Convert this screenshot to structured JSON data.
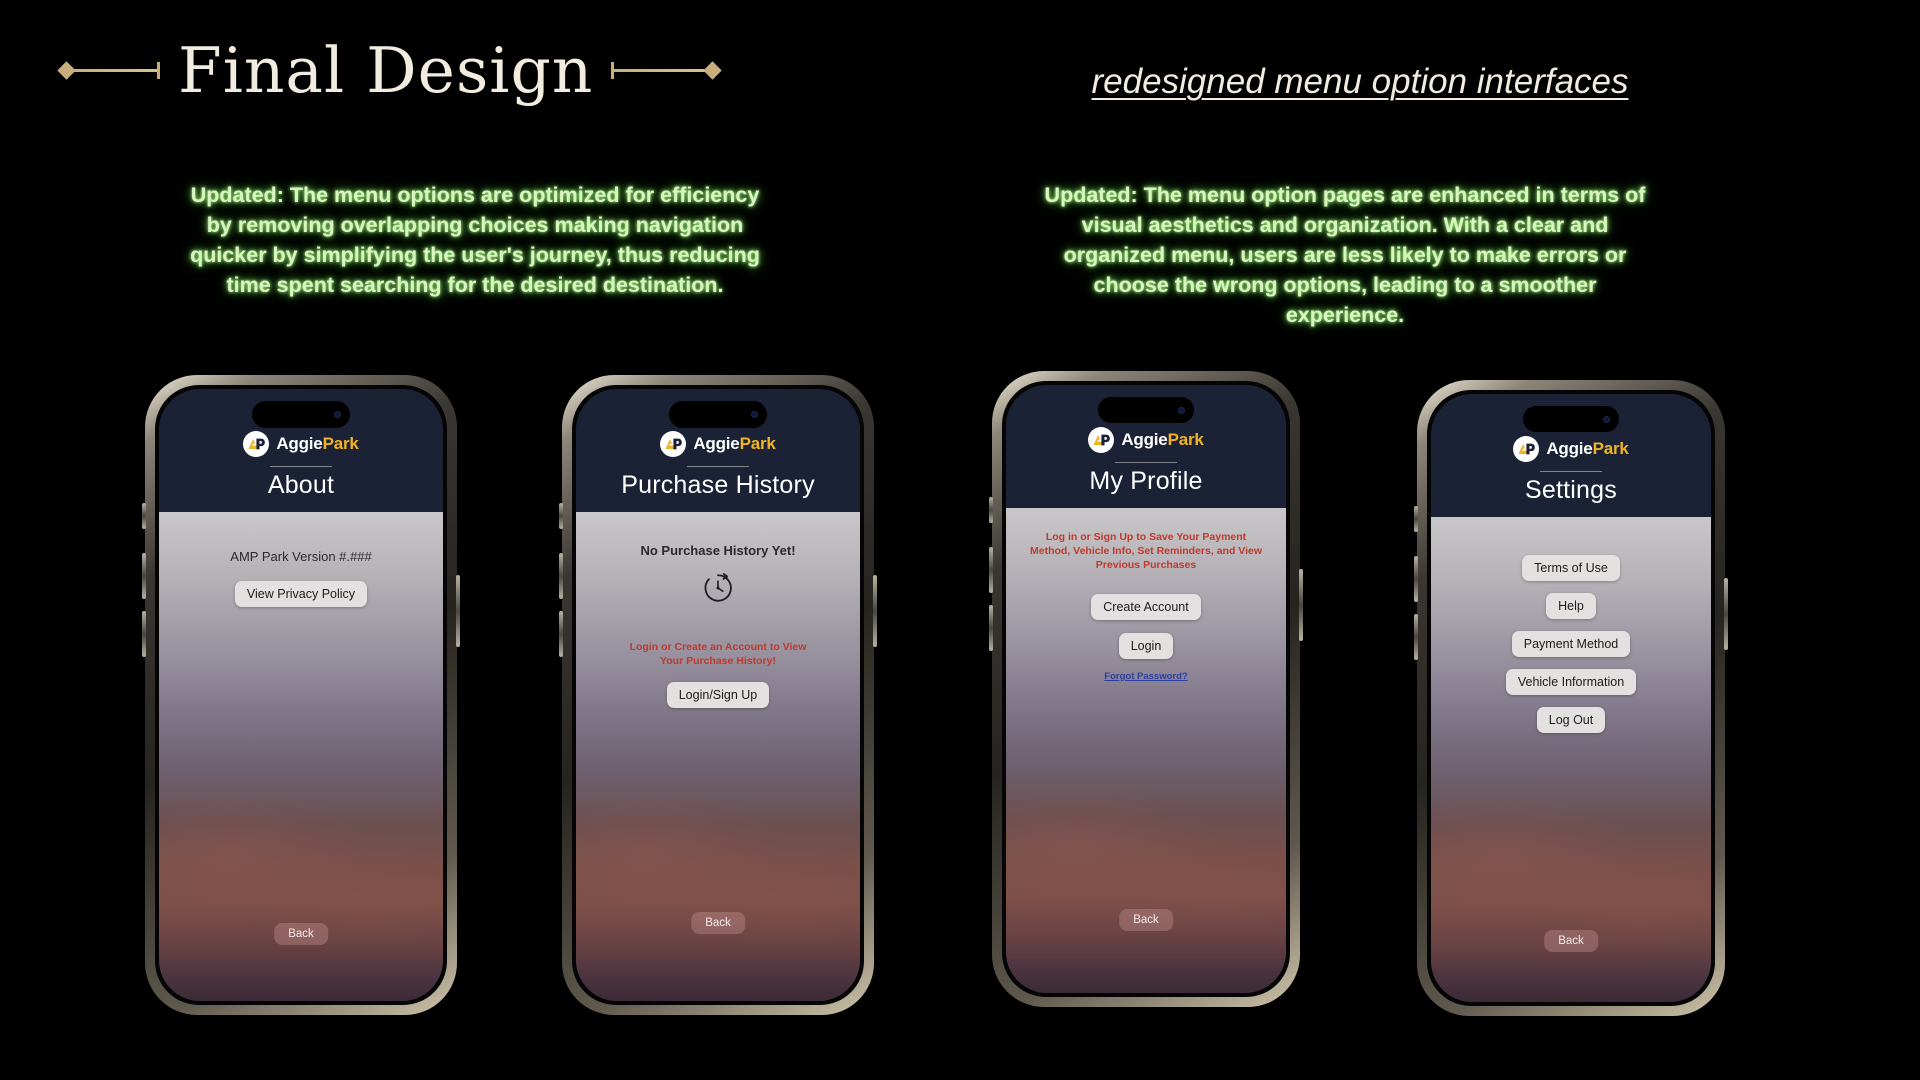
{
  "slide": {
    "title_left": "Final Design",
    "title_right": "redesigned menu option interfaces",
    "caption_left": "Updated: The menu options are optimized for efficiency by removing overlapping choices making navigation quicker by simplifying the user's journey, thus reducing time spent searching for the desired destination.",
    "caption_right": "Updated: The menu option pages are enhanced in terms of visual aesthetics and organization. With a clear and organized menu, users are less likely to make errors or choose the wrong options, leading to a smoother experience.",
    "colors": {
      "background": "#000000",
      "ornament_gold": "#c9ae7c",
      "title_cream": "#f2ece0",
      "caption_green": "#d9f5c0",
      "brand_yellow": "#f0b323",
      "app_header_navy": "#1c2235",
      "error_red": "#c0392b",
      "link_blue": "#2b3fa0"
    }
  },
  "brand": {
    "name_first": "Aggie",
    "name_second": "Park",
    "logo_icon": "ap-monogram-icon"
  },
  "phones": [
    {
      "id": "about",
      "screen_title": "About",
      "version_label": "AMP Park Version #.###",
      "privacy_button": "View Privacy Policy",
      "back_button": "Back"
    },
    {
      "id": "purchase-history",
      "screen_title": "Purchase History",
      "empty_label": "No Purchase History Yet!",
      "history_icon": "clock-history-icon",
      "warning_text": "Login or Create an Account to View Your Purchase History!",
      "login_signup_button": "Login/Sign Up",
      "back_button": "Back"
    },
    {
      "id": "my-profile",
      "screen_title": "My Profile",
      "warning_text": "Log in or Sign Up to Save Your Payment Method, Vehicle Info, Set Reminders, and View Previous Purchases",
      "create_account_button": "Create Account",
      "login_button": "Login",
      "forgot_password_link": "Forgot Password?",
      "back_button": "Back"
    },
    {
      "id": "settings",
      "screen_title": "Settings",
      "options": [
        "Terms of Use",
        "Help",
        "Payment Method",
        "Vehicle Information",
        "Log Out"
      ],
      "back_button": "Back"
    }
  ]
}
